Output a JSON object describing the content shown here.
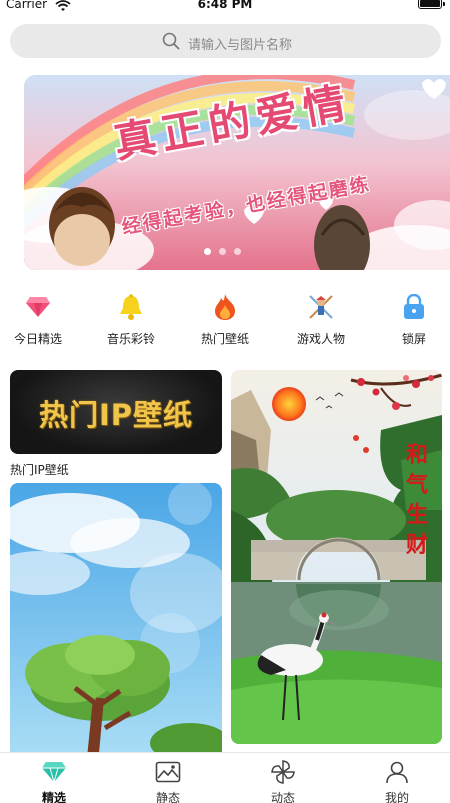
{
  "status_bar": {
    "carrier": "Carrier",
    "time": "6:48 PM"
  },
  "search": {
    "placeholder": "请输入与图片名称",
    "icon": "search-icon"
  },
  "banner": {
    "title": "真正的爱情",
    "subtitle": "经得起考验，也经得起磨练",
    "page_count": 3,
    "active_page": 1
  },
  "categories": [
    {
      "label": "今日精选",
      "icon": "diamond-icon",
      "color": "#f0507a"
    },
    {
      "label": "音乐彩铃",
      "icon": "bell-icon",
      "color": "#f5d21b"
    },
    {
      "label": "热门壁纸",
      "icon": "fire-icon",
      "color": "#f0541e"
    },
    {
      "label": "游戏人物",
      "icon": "character-icon",
      "color": "#7aa7d8"
    },
    {
      "label": "锁屏",
      "icon": "lock-icon",
      "color": "#4aa3f0"
    }
  ],
  "feed": {
    "ip_card_text": "热门IP壁纸",
    "ip_card_label": "热门IP壁纸",
    "scene_card_text": "和气生财"
  },
  "tabbar": {
    "items": [
      {
        "label": "精选",
        "icon": "diamond-icon",
        "active": true
      },
      {
        "label": "静态",
        "icon": "image-icon",
        "active": false
      },
      {
        "label": "动态",
        "icon": "pinwheel-icon",
        "active": false
      },
      {
        "label": "我的",
        "icon": "person-icon",
        "active": false
      }
    ],
    "accent": "#2bbfa8"
  }
}
